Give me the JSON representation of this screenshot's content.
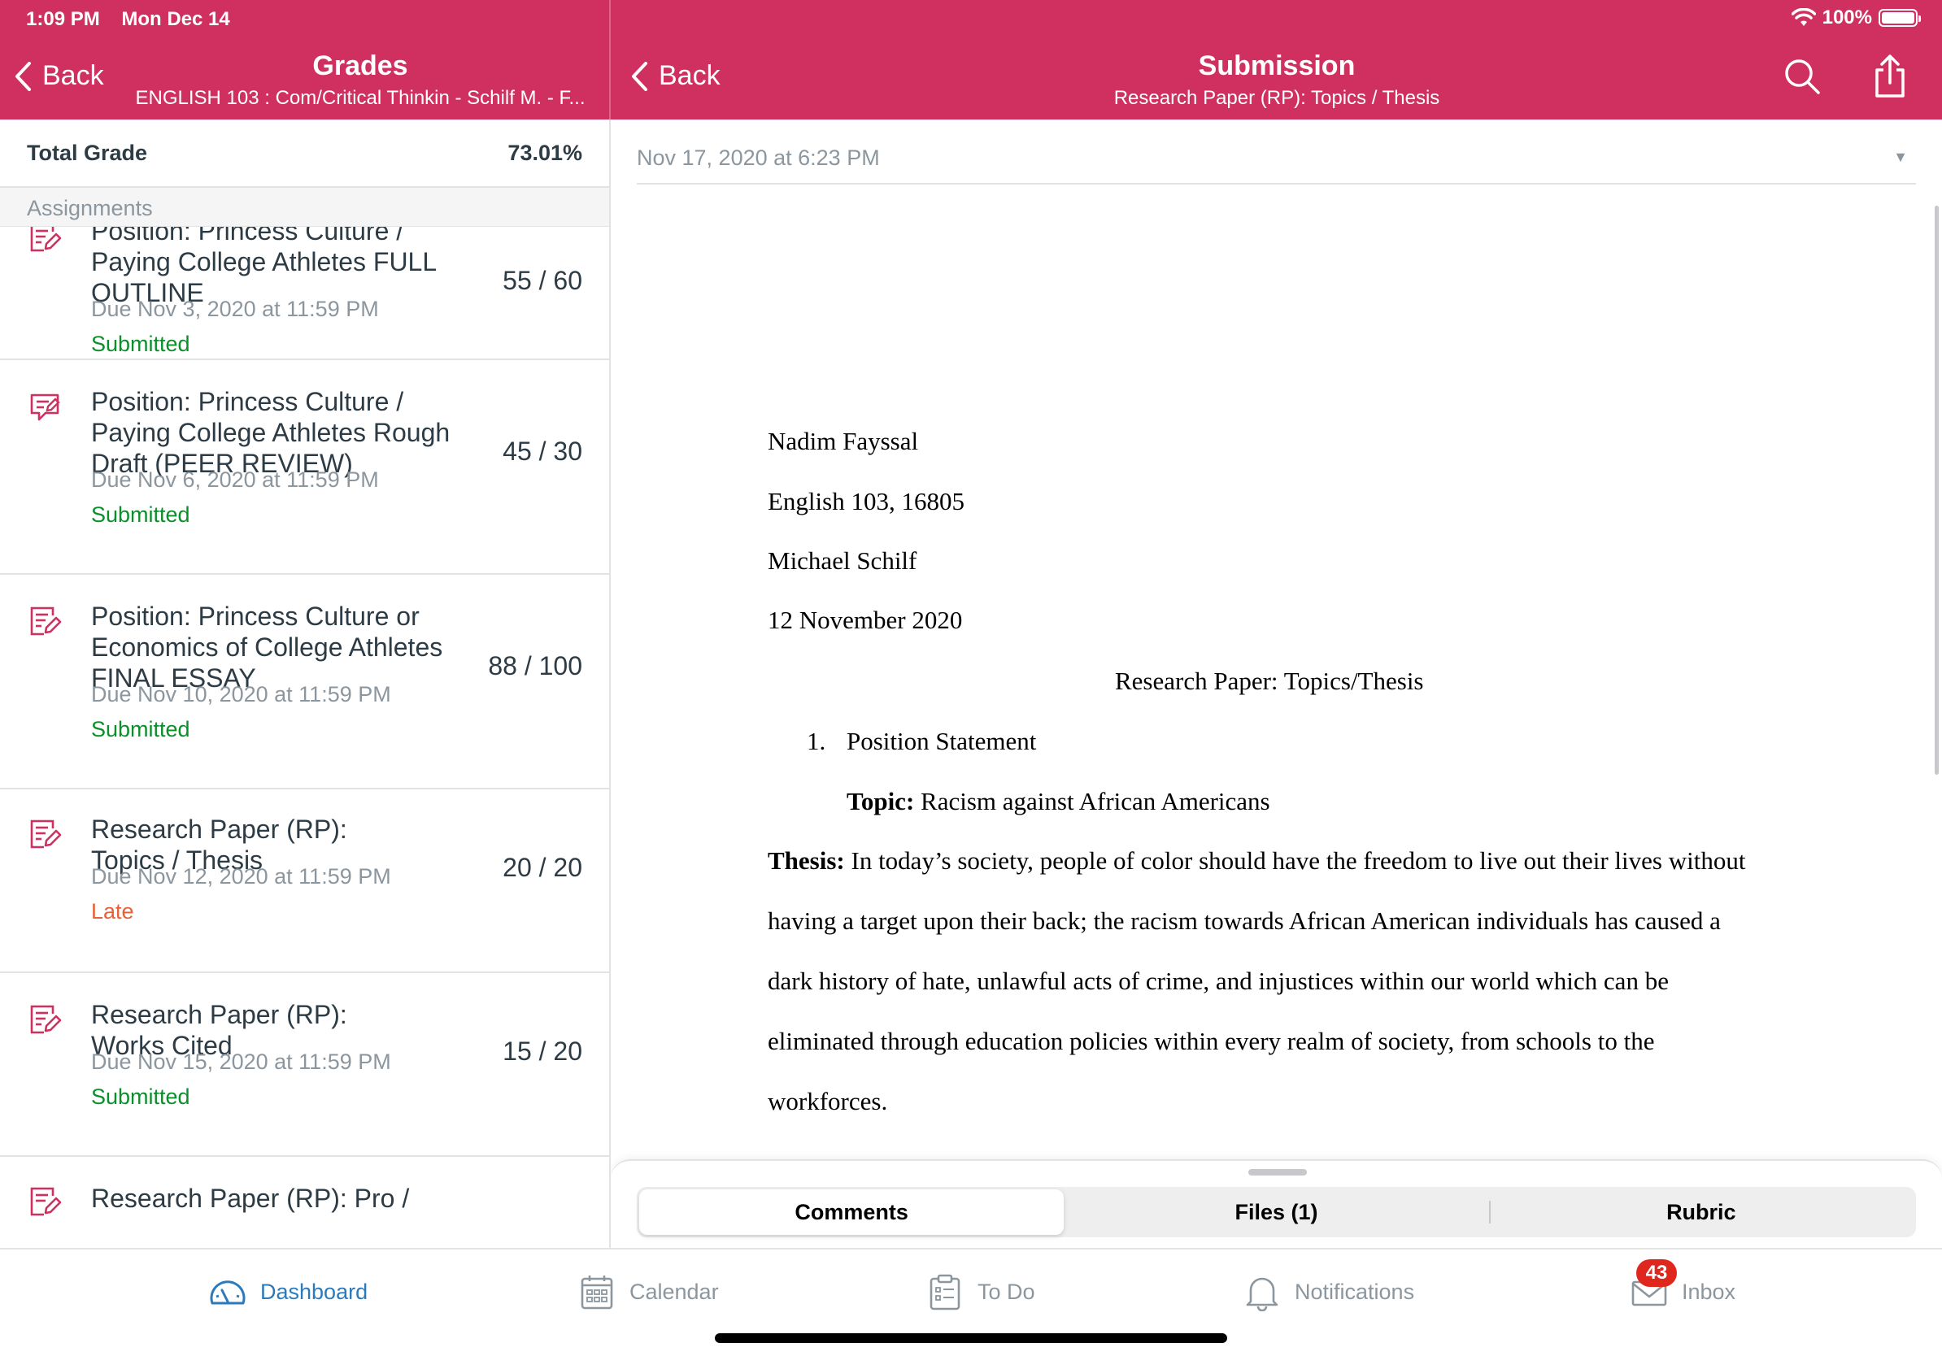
{
  "status_bar": {
    "time": "1:09 PM",
    "date": "Mon Dec 14",
    "battery": "100%"
  },
  "left_nav": {
    "back_label": "Back",
    "title": "Grades",
    "subtitle": "ENGLISH 103 : Com/Critical Thinkin - Schilf M. - F..."
  },
  "right_nav": {
    "back_label": "Back",
    "title": "Submission",
    "subtitle": "Research Paper (RP): Topics / Thesis"
  },
  "grades": {
    "total_label": "Total Grade",
    "total_value": "73.01%",
    "section_label": "Assignments",
    "items": [
      {
        "icon": "assignment-icon",
        "name": "Position: Princess Culture / Paying College Athletes FULL OUTLINE",
        "due": "Due Nov 3, 2020 at 11:59 PM",
        "status": "Submitted",
        "score": "55 / 60"
      },
      {
        "icon": "peer-review-icon",
        "name": "Position: Princess Culture / Paying College Athletes Rough Draft (PEER REVIEW)",
        "due": "Due Nov 6, 2020 at 11:59 PM",
        "status": "Submitted",
        "score": "45 / 30"
      },
      {
        "icon": "assignment-icon",
        "name": "Position: Princess Culture or Economics of College Athletes FINAL ESSAY",
        "due": "Due Nov 10, 2020 at 11:59 PM",
        "status": "Submitted",
        "score": "88 / 100"
      },
      {
        "icon": "assignment-icon",
        "name": "Research Paper (RP): Topics / Thesis",
        "due": "Due Nov 12, 2020 at 11:59 PM",
        "status": "Late",
        "score": "20 / 20"
      },
      {
        "icon": "assignment-icon",
        "name": "Research Paper (RP): Works Cited",
        "due": "Due Nov 15, 2020 at 11:59 PM",
        "status": "Submitted",
        "score": "15 / 20"
      },
      {
        "icon": "assignment-icon",
        "name": "Research Paper (RP): Pro /",
        "due": "",
        "status": "",
        "score": ""
      }
    ]
  },
  "submission": {
    "attempt_date": "Nov 17, 2020 at 6:23 PM",
    "document": {
      "author": "Nadim Fayssal",
      "course": "English 103, 16805",
      "instructor": "Michael Schilf",
      "date": "12 November 2020",
      "title": "Research Paper: Topics/Thesis",
      "list_number": "1.",
      "list_item": "Position Statement",
      "topic_label": "Topic:",
      "topic_text": " Racism against African Americans",
      "thesis_label": "Thesis:",
      "thesis_lines": [
        " In today’s society, people of color should have the freedom to live out their lives without",
        "having a target upon their back; the racism towards African American individuals has caused a",
        "dark history of hate, unlawful acts of crime, and injustices within our world which can be",
        "eliminated through education policies within every realm of society, from schools to the",
        "workforces."
      ]
    },
    "tabs": [
      "Comments",
      "Files (1)",
      "Rubric"
    ]
  },
  "tabbar": {
    "items": [
      {
        "label": "Dashboard",
        "icon": "dashboard-icon"
      },
      {
        "label": "Calendar",
        "icon": "calendar-icon"
      },
      {
        "label": "To Do",
        "icon": "todo-icon"
      },
      {
        "label": "Notifications",
        "icon": "bell-icon"
      },
      {
        "label": "Inbox",
        "icon": "inbox-icon",
        "badge": "43"
      }
    ]
  },
  "colors": {
    "brand": "#d0305f",
    "submitted": "#0b8f2a",
    "late": "#e66135",
    "active_tab": "#2b7abc",
    "badge": "#e0271e"
  }
}
